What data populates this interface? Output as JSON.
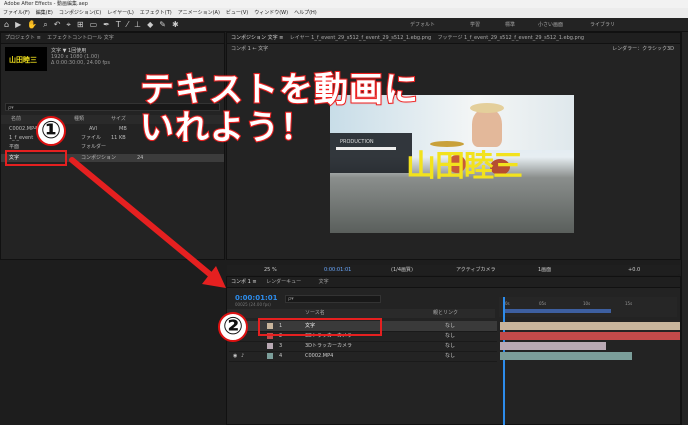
{
  "window_title": "Adobe After Effects - 動画編集.aep",
  "menu": [
    "ファイル(F)",
    "編集(E)",
    "コンポジション(C)",
    "レイヤー(L)",
    "エフェクト(T)",
    "アニメーション(A)",
    "ビュー(V)",
    "ウィンドウ(W)",
    "ヘルプ(H)"
  ],
  "workspaces": [
    "デフォルト",
    "学習",
    "標準",
    "小さい画面",
    "ライブラリ"
  ],
  "project_panel": {
    "tab_label": "プロジェクト ≡",
    "effect_tab": "エフェクトコントロール 文字",
    "item_name": "文字 ▼ 1回使用",
    "item_info": [
      "1920 x 1080 (1.00)",
      "Δ 0:00:30:00, 24.00 fps"
    ],
    "thumb_text": "山田睦三",
    "search_placeholder": "ρ▾",
    "columns": [
      "名前",
      "種類",
      "サイズ"
    ],
    "rows": [
      {
        "name": "C0002.MP4",
        "type": "AVI",
        "size": "MB"
      },
      {
        "name": "1_f_event",
        "type": "ファイル",
        "size": "11 KB"
      },
      {
        "name": "文字",
        "type": "コンポジション",
        "size": "24"
      },
      {
        "name": "平面",
        "type": "フォルダー",
        "size": ""
      }
    ]
  },
  "comp_panel": {
    "tabs": [
      "コンポジション 文字 ≡",
      "レイヤー 1_f_event_29_s512_f_event_29_s512_1.ebg.png",
      "フッテージ 1_f_event_29_s512_f_event_29_s512_1.ebg.png"
    ],
    "breadcrumb": [
      "コンポ 1",
      "文字"
    ],
    "renderer": "レンダラー：クラシック3D",
    "logo_text": "山田睦三",
    "production_text": "PRODUCTION",
    "footer": [
      "25 %",
      "0:00:01:01",
      "(1/4画質)",
      "アクティブカメラ",
      "1画面",
      "+0.0"
    ]
  },
  "overlay": {
    "headline_line1": "テキストを動画に",
    "headline_line2": "いれよう！",
    "marker1": "①",
    "marker2": "②"
  },
  "timeline": {
    "tabs": [
      "コンポ 1 ≡",
      "レンダーキュー",
      "文字"
    ],
    "timecode": "0:00:01:01",
    "frame_info": "00025 (24.00 fps)",
    "search_placeholder": "ρ▾",
    "columns": [
      "ソース名",
      "親とリンク"
    ],
    "parent_value": "なし",
    "layers": [
      {
        "num": "1",
        "name": "文字",
        "color": "#c9b59c"
      },
      {
        "num": "2",
        "name": "3Dトラッカーカメラ",
        "color": "#c24a4a"
      },
      {
        "num": "3",
        "name": "3Dトラッカーカメラ",
        "color": "#b9a9b4"
      },
      {
        "num": "4",
        "name": "C0002.MP4",
        "color": "#7b9e9a"
      }
    ],
    "ruler_ticks": [
      "0s",
      "05s",
      "10s",
      "15s"
    ]
  },
  "accent": "#2d8ceb",
  "annotation_color": "#e52020"
}
